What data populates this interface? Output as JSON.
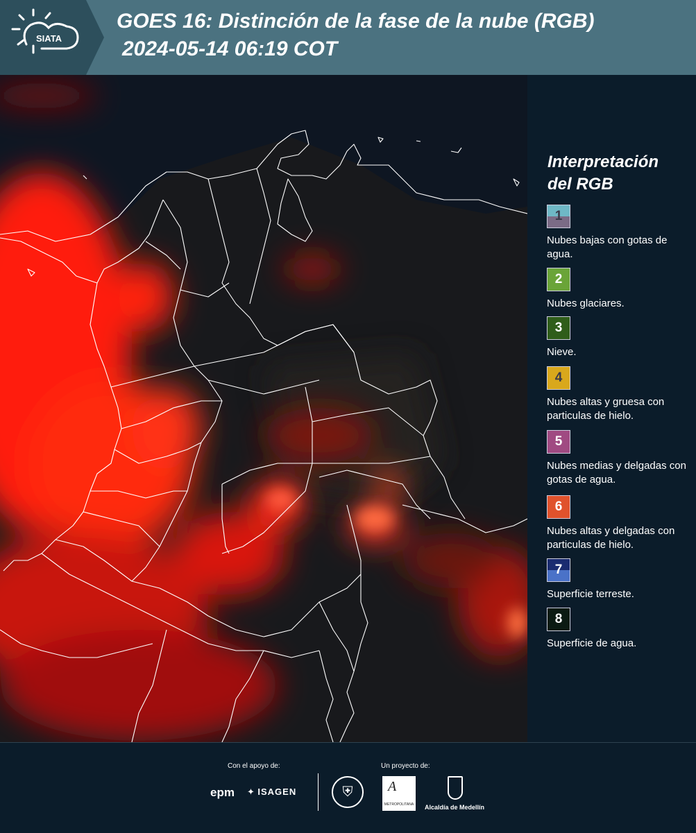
{
  "header": {
    "logo_text": "SIATA",
    "title_line1": "GOES 16: Distinción de la fase de la nube (RGB)",
    "title_line2": "2024-05-14 06:19 COT"
  },
  "legend": {
    "title": "Interpretación del RGB",
    "items": [
      {
        "number": "1",
        "label": "Nubes bajas con gotas de agua.",
        "color_top": "#6fb8c6",
        "color_bottom": "#7b6b86",
        "number_color": "#3a3a4a"
      },
      {
        "number": "2",
        "label": "Nubes glaciares.",
        "color_top": "#6aa438",
        "color_bottom": "#6aa438",
        "number_color": "#ffffff"
      },
      {
        "number": "3",
        "label": "Nieve.",
        "color_top": "#2f5d1a",
        "color_bottom": "#2f5d1a",
        "number_color": "#ffffff"
      },
      {
        "number": "4",
        "label": "Nubes altas y gruesa con particulas de hielo.",
        "color_top": "#d9a81c",
        "color_bottom": "#d9a81c",
        "number_color": "#3a3a4a"
      },
      {
        "number": "5",
        "label": "Nubes medias y delgadas con gotas de agua.",
        "color_top": "#a04a82",
        "color_bottom": "#a04a82",
        "number_color": "#ffffff"
      },
      {
        "number": "6",
        "label": "Nubes altas y delgadas con particulas de hielo.",
        "color_top": "#e0522c",
        "color_bottom": "#e0522c",
        "number_color": "#ffffff"
      },
      {
        "number": "7",
        "label": "Superficie terreste.",
        "color_top": "#1a2c70",
        "color_bottom": "#4a72c8",
        "number_color": "#ffffff"
      },
      {
        "number": "8",
        "label": "Superficie de agua.",
        "color_top": "#0b1a12",
        "color_bottom": "#0b1a12",
        "number_color": "#ffffff"
      }
    ]
  },
  "footer": {
    "support_label": "Con el apoyo de:",
    "project_label": "Un proyecto de:",
    "epm": "epm",
    "isagen": "ISAGEN",
    "area_metropolitana": "METROPOLITANA",
    "alcaldia": "Alcaldía de Medellín"
  },
  "colors": {
    "header_bg": "#4b7280",
    "header_tab": "#2d4f5c",
    "panel_bg": "#0b1c2a",
    "cloud_red": "#ff1a0a"
  }
}
